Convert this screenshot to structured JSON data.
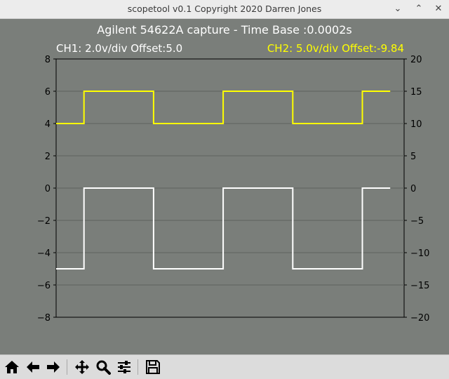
{
  "window": {
    "title": "scopetool v0.1 Copyright 2020 Darren Jones",
    "minimize_glyph": "⌄",
    "maximize_glyph": "⌃",
    "close_glyph": "✕"
  },
  "toolbar": {
    "buttons": [
      "home-icon",
      "back-arrow-icon",
      "forward-arrow-icon",
      "pan-move-icon",
      "zoom-magnifier-icon",
      "configure-subplots-icon",
      "save-floppy-icon"
    ]
  },
  "colors": {
    "background": "#7a7e7a",
    "ch1": "#ffffff",
    "ch2": "#ffff00",
    "grid": "#5f635f"
  },
  "chart_data": {
    "type": "line",
    "title": "Agilent 54622A capture - Time Base :0.0002s",
    "left_label": "CH1: 2.0v/div Offset:5.0",
    "right_label": "CH2: 5.0v/div Offset:-9.84",
    "x_ticks_visible": false,
    "grid": "horizontal",
    "y_left": {
      "ylim": [
        -8,
        8
      ],
      "ticks": [
        "8",
        "6",
        "4",
        "2",
        "0",
        "−2",
        "−4",
        "−6",
        "−8"
      ]
    },
    "y_right": {
      "ylim": [
        -20,
        20
      ],
      "ticks": [
        "20",
        "15",
        "10",
        "5",
        "0",
        "−5",
        "−10",
        "−15",
        "−20"
      ]
    },
    "series": [
      {
        "name": "CH1: 2.0v/div Offset:5.0",
        "axis": "left",
        "x": [
          0,
          8,
          8,
          28,
          28,
          48,
          48,
          68,
          68,
          88,
          88,
          96
        ],
        "y": [
          -5,
          -5,
          0,
          0,
          -5,
          -5,
          0,
          0,
          -5,
          -5,
          0,
          0
        ]
      },
      {
        "name": "CH2: 5.0v/div Offset:-9.84",
        "axis": "right",
        "x": [
          0,
          8,
          8,
          28,
          28,
          48,
          48,
          68,
          68,
          88,
          88,
          96
        ],
        "y": [
          10,
          10,
          15,
          15,
          10,
          10,
          15,
          15,
          10,
          10,
          15,
          15
        ]
      }
    ]
  }
}
